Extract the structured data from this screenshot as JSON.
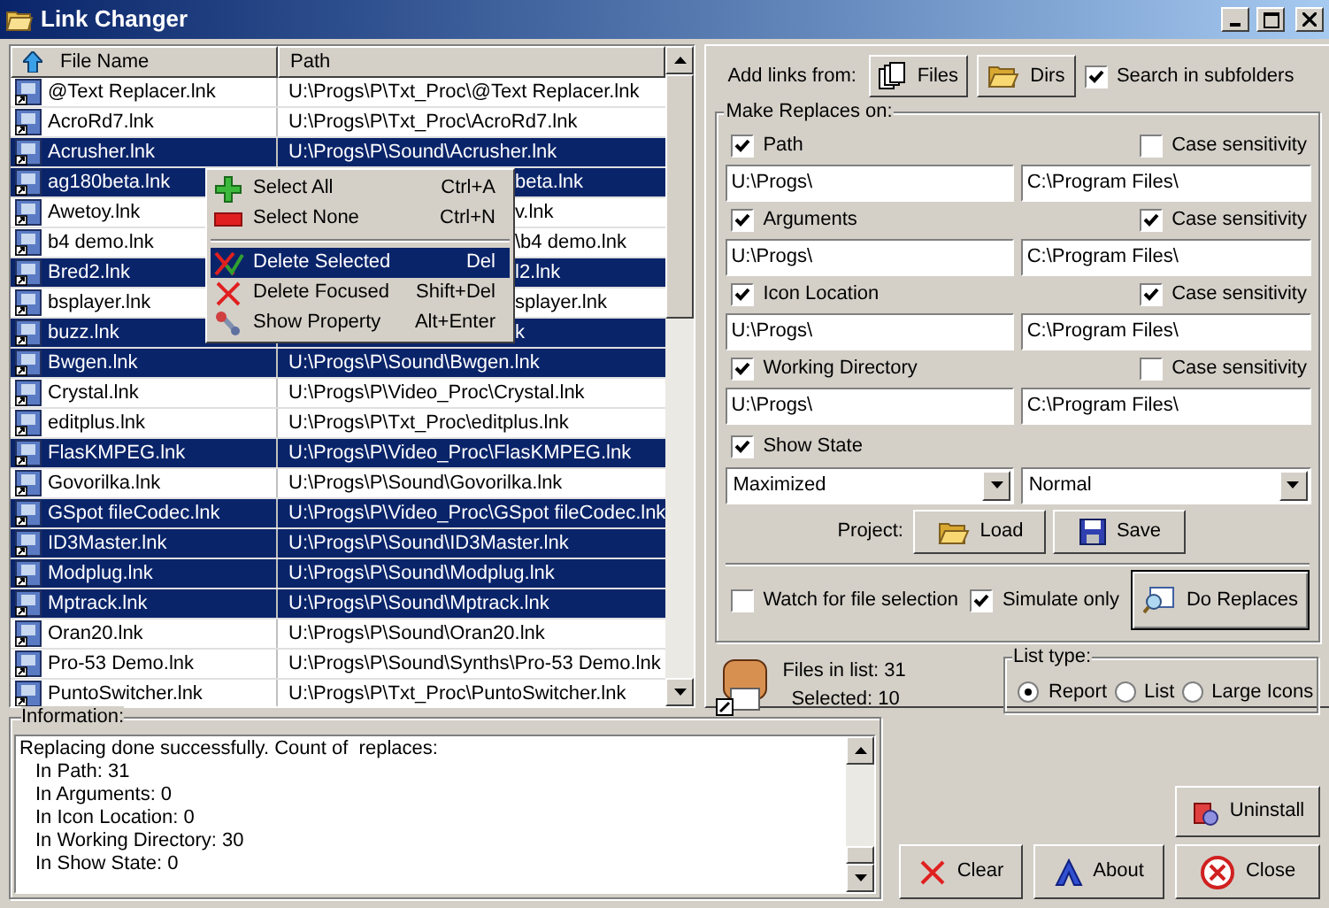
{
  "window": {
    "title": "Link Changer"
  },
  "file_list": {
    "columns": [
      "File Name",
      "Path"
    ],
    "rows": [
      {
        "name": "@Text Replacer.lnk",
        "path": "U:\\Progs\\P\\Txt_Proc\\@Text Replacer.lnk",
        "selected": false,
        "covered": false
      },
      {
        "name": "AcroRd7.lnk",
        "path": "U:\\Progs\\P\\Txt_Proc\\AcroRd7.lnk",
        "selected": false,
        "covered": false
      },
      {
        "name": "Acrusher.lnk",
        "path": "U:\\Progs\\P\\Sound\\Acrusher.lnk",
        "selected": true,
        "covered": false
      },
      {
        "name": "ag180beta.lnk",
        "path": "beta.lnk",
        "selected": true,
        "covered": true
      },
      {
        "name": "Awetoy.lnk",
        "path": "v.lnk",
        "selected": false,
        "covered": true
      },
      {
        "name": "b4 demo.lnk",
        "path": "\\b4 demo.lnk",
        "selected": false,
        "covered": true
      },
      {
        "name": "Bred2.lnk",
        "path": "l2.lnk",
        "selected": true,
        "covered": true
      },
      {
        "name": "bsplayer.lnk",
        "path": "splayer.lnk",
        "selected": false,
        "covered": true
      },
      {
        "name": "buzz.lnk",
        "path": "k",
        "selected": true,
        "covered": true
      },
      {
        "name": "Bwgen.lnk",
        "path": "U:\\Progs\\P\\Sound\\Bwgen.lnk",
        "selected": true,
        "covered": false
      },
      {
        "name": "Crystal.lnk",
        "path": "U:\\Progs\\P\\Video_Proc\\Crystal.lnk",
        "selected": false,
        "covered": false
      },
      {
        "name": "editplus.lnk",
        "path": "U:\\Progs\\P\\Txt_Proc\\editplus.lnk",
        "selected": false,
        "covered": false
      },
      {
        "name": "FlasKMPEG.lnk",
        "path": "U:\\Progs\\P\\Video_Proc\\FlasKMPEG.lnk",
        "selected": true,
        "covered": false
      },
      {
        "name": "Govorilka.lnk",
        "path": "U:\\Progs\\P\\Sound\\Govorilka.lnk",
        "selected": false,
        "covered": false
      },
      {
        "name": "GSpot fileCodec.lnk",
        "path": "U:\\Progs\\P\\Video_Proc\\GSpot fileCodec.lnk",
        "selected": true,
        "covered": false
      },
      {
        "name": "ID3Master.lnk",
        "path": "U:\\Progs\\P\\Sound\\ID3Master.lnk",
        "selected": true,
        "covered": false
      },
      {
        "name": "Modplug.lnk",
        "path": "U:\\Progs\\P\\Sound\\Modplug.lnk",
        "selected": true,
        "covered": false
      },
      {
        "name": "Mptrack.lnk",
        "path": "U:\\Progs\\P\\Sound\\Mptrack.lnk",
        "selected": true,
        "covered": false
      },
      {
        "name": "Oran20.lnk",
        "path": "U:\\Progs\\P\\Sound\\Oran20.lnk",
        "selected": false,
        "covered": false
      },
      {
        "name": "Pro-53 Demo.lnk",
        "path": "U:\\Progs\\P\\Sound\\Synths\\Pro-53 Demo.lnk",
        "selected": false,
        "covered": false
      },
      {
        "name": "PuntoSwitcher.lnk",
        "path": "U:\\Progs\\P\\Txt_Proc\\PuntoSwitcher.lnk",
        "selected": false,
        "covered": false
      }
    ]
  },
  "context_menu": {
    "items": [
      {
        "kind": "item",
        "label": "Select All",
        "shortcut": "Ctrl+A",
        "highlighted": false
      },
      {
        "kind": "item",
        "label": "Select None",
        "shortcut": "Ctrl+N",
        "highlighted": false
      },
      {
        "kind": "separator"
      },
      {
        "kind": "item",
        "label": "Delete Selected",
        "shortcut": "Del",
        "highlighted": true
      },
      {
        "kind": "item",
        "label": "Delete Focused",
        "shortcut": "Shift+Del",
        "highlighted": false
      },
      {
        "kind": "item",
        "label": "Show Property",
        "shortcut": "Alt+Enter",
        "highlighted": false
      }
    ]
  },
  "add_links": {
    "label": "Add links from:",
    "buttons": [
      "Files",
      "Dirs"
    ],
    "search_subfolders": {
      "label": "Search in subfolders",
      "checked": true
    }
  },
  "replaces": {
    "title": "Make Replaces on:",
    "fields": [
      {
        "label": "Path",
        "checked": true,
        "case_label": "Case sensitivity",
        "case_checked": false,
        "find": "U:\\Progs\\",
        "replace": "C:\\Program Files\\"
      },
      {
        "label": "Arguments",
        "checked": true,
        "case_label": "Case sensitivity",
        "case_checked": true,
        "find": "U:\\Progs\\",
        "replace": "C:\\Program Files\\"
      },
      {
        "label": "Icon Location",
        "checked": true,
        "case_label": "Case sensitivity",
        "case_checked": true,
        "find": "U:\\Progs\\",
        "replace": "C:\\Program Files\\"
      },
      {
        "label": "Working Directory",
        "checked": true,
        "case_label": "Case sensitivity",
        "case_checked": false,
        "find": "U:\\Progs\\",
        "replace": "C:\\Program Files\\"
      }
    ],
    "show_state": {
      "label": "Show State",
      "checked": true,
      "from": "Maximized",
      "to": "Normal"
    },
    "project": {
      "label": "Project:",
      "load": "Load",
      "save": "Save"
    },
    "watch": {
      "label": "Watch for file selection",
      "checked": false
    },
    "simulate": {
      "label": "Simulate only",
      "checked": true
    },
    "do_replaces": "Do Replaces"
  },
  "stats": {
    "files": "Files in list: 31",
    "selected": "Selected: 10"
  },
  "list_type": {
    "title": "List type:",
    "options": [
      {
        "label": "Report",
        "selected": true
      },
      {
        "label": "List",
        "selected": false
      },
      {
        "label": "Large Icons",
        "selected": false
      }
    ]
  },
  "information": {
    "title": "Information:",
    "lines": [
      {
        "text": "Replacing done successfully. Count of  replaces:",
        "children": [
          {
            "text": "In Path: 31"
          },
          {
            "text": "In Arguments: 0"
          },
          {
            "text": "In Icon Location: 0"
          },
          {
            "text": "In Working Directory: 30"
          },
          {
            "text": "In Show State: 0"
          }
        ]
      }
    ]
  },
  "buttons": {
    "uninstall": "Uninstall",
    "clear": "Clear",
    "about": "About",
    "close": "Close"
  }
}
